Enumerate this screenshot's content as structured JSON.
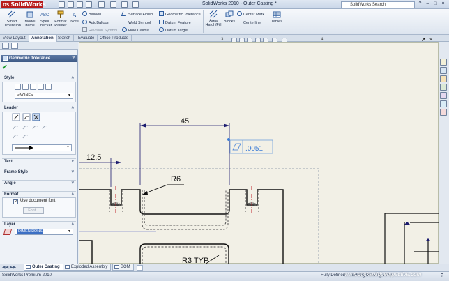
{
  "app": {
    "logo_prefix": "DS",
    "logo": "SolidWorks",
    "window_title": "SolidWorks 2010 - Outer Casting *",
    "search_placeholder": "SolidWorks Search"
  },
  "ribbon": {
    "smart_dimension": "Smart\nDimension",
    "model_items": "Model\nItems",
    "spell_checker": "Spell\nChecker",
    "format_painter": "Format\nPainter",
    "note": "Note",
    "balloon": "Balloon",
    "autoballoon": "AutoBalloon",
    "revision_symbol": "Revision Symbol",
    "surface_finish": "Surface Finish",
    "weld_symbol": "Weld Symbol",
    "hole_callout": "Hole Callout",
    "geometric_tolerance": "Geometric Tolerance",
    "datum_feature": "Datum Feature",
    "datum_target": "Datum Target",
    "area_hatch": "Area\nHatch/Fill",
    "blocks": "Blocks",
    "center_mark": "Center Mark",
    "centerline": "Centerline",
    "tables": "Tables"
  },
  "tabs": [
    "View Layout",
    "Annotation",
    "Sketch",
    "Evaluate",
    "Office Products"
  ],
  "active_tab": "Annotation",
  "panel": {
    "title": "Geometric Tolerance",
    "help": "?",
    "style_label": "Style",
    "style_value": "<NONE>",
    "leader_label": "Leader",
    "text_label": "Text",
    "frame_style_label": "Frame Style",
    "angle_label": "Angle",
    "format_label": "Format",
    "use_doc_font": "Use document font",
    "font_button": "Font...",
    "layer_label": "Layer",
    "layer_value": "DIMENSIONS"
  },
  "viewbar": {
    "sheet_number": "3",
    "sheet_number_2": "4"
  },
  "drawing": {
    "dim_45": "45",
    "dim_12_5": "12.5",
    "radius_r6": "R6",
    "radius_r3": "R3 TYP",
    "tolerance_value": ".0051"
  },
  "sheet_tabs": [
    "Outer Casting",
    "Exploded Assembly",
    "BOM"
  ],
  "active_sheet": "Outer Casting",
  "status": {
    "product": "SolidWorks Premium 2010",
    "state": "Fully Defined",
    "mode": "Editing Drawing View1"
  },
  "watermark": "www.cocksolidperspective.com",
  "colors": {
    "dimension": "#1b1b6e",
    "geometry": "#111111",
    "selection": "#3b7bd6",
    "panel_header": "#3e5a86",
    "logo": "#b81c1c"
  }
}
